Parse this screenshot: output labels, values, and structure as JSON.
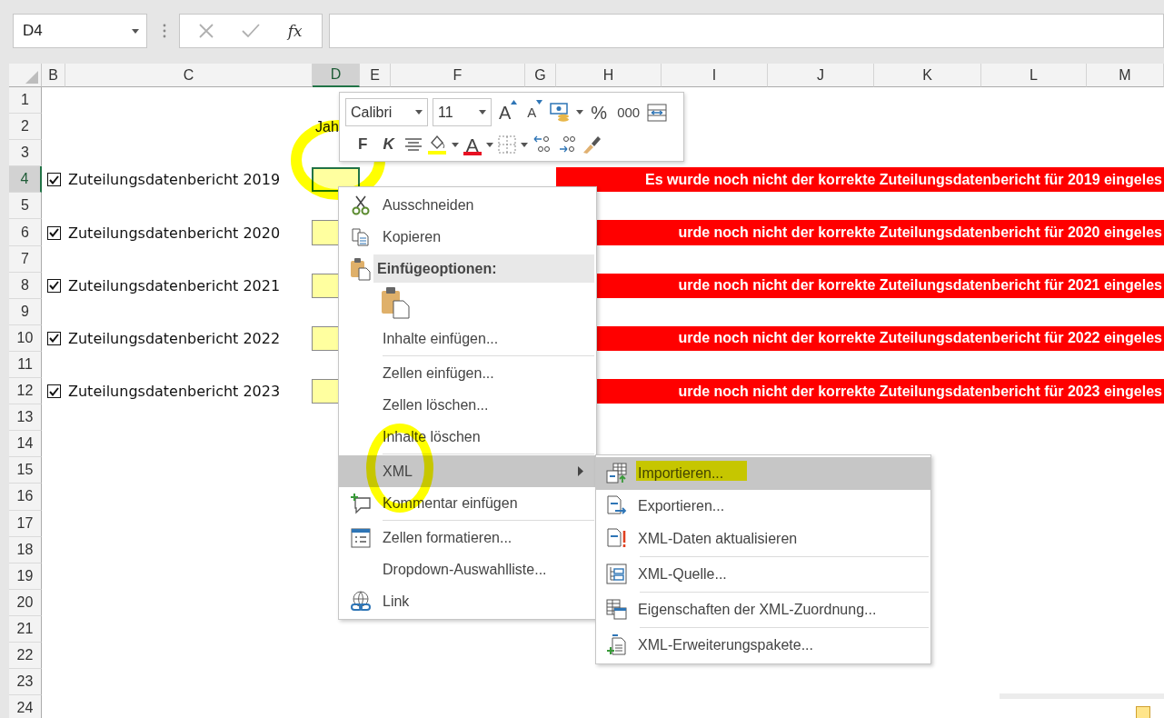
{
  "formula_bar": {
    "name_box": "D4",
    "function_label": "fx"
  },
  "columns": [
    {
      "label": "B",
      "selected": false
    },
    {
      "label": "C",
      "selected": false
    },
    {
      "label": "D",
      "selected": true
    },
    {
      "label": "E",
      "selected": false
    },
    {
      "label": "F",
      "selected": false
    },
    {
      "label": "G",
      "selected": false
    },
    {
      "label": "H",
      "selected": false
    },
    {
      "label": "I",
      "selected": false
    },
    {
      "label": "J",
      "selected": false
    },
    {
      "label": "K",
      "selected": false
    },
    {
      "label": "L",
      "selected": false
    },
    {
      "label": "M",
      "selected": false
    }
  ],
  "rows": [
    {
      "header": "1",
      "selected": false
    },
    {
      "header": "2",
      "selected": false,
      "note": "Jah"
    },
    {
      "header": "3",
      "selected": false
    },
    {
      "header": "4",
      "selected": true,
      "checkbox": {
        "checked": true,
        "label": "Zuteilungsdatenbericht 2019"
      },
      "input_cell": {
        "selected": true
      },
      "warning": "Es wurde noch nicht der korrekte Zuteilungsdatenbericht für 2019 eingeles"
    },
    {
      "header": "5",
      "selected": false
    },
    {
      "header": "6",
      "selected": false,
      "checkbox": {
        "checked": true,
        "label": "Zuteilungsdatenbericht 2020"
      },
      "input_cell": {
        "selected": false
      },
      "warning": "urde noch nicht der korrekte Zuteilungsdatenbericht für 2020 eingeles"
    },
    {
      "header": "7",
      "selected": false
    },
    {
      "header": "8",
      "selected": false,
      "checkbox": {
        "checked": true,
        "label": "Zuteilungsdatenbericht 2021"
      },
      "input_cell": {
        "selected": false
      },
      "warning": "urde noch nicht der korrekte Zuteilungsdatenbericht für 2021 eingeles"
    },
    {
      "header": "9",
      "selected": false
    },
    {
      "header": "10",
      "selected": false,
      "checkbox": {
        "checked": true,
        "label": "Zuteilungsdatenbericht 2022"
      },
      "input_cell": {
        "selected": false
      },
      "warning": "urde noch nicht der korrekte Zuteilungsdatenbericht für 2022 eingeles"
    },
    {
      "header": "11",
      "selected": false
    },
    {
      "header": "12",
      "selected": false,
      "checkbox": {
        "checked": true,
        "label": "Zuteilungsdatenbericht 2023"
      },
      "input_cell": {
        "selected": false
      },
      "warning": "urde noch nicht der korrekte Zuteilungsdatenbericht für 2023 eingeles"
    },
    {
      "header": "13",
      "selected": false
    },
    {
      "header": "14",
      "selected": false
    },
    {
      "header": "15",
      "selected": false
    },
    {
      "header": "16",
      "selected": false
    },
    {
      "header": "17",
      "selected": false
    },
    {
      "header": "18",
      "selected": false
    },
    {
      "header": "19",
      "selected": false
    },
    {
      "header": "20",
      "selected": false
    },
    {
      "header": "21",
      "selected": false
    },
    {
      "header": "22",
      "selected": false
    },
    {
      "header": "23",
      "selected": false
    },
    {
      "header": "24",
      "selected": false
    }
  ],
  "mini_toolbar": {
    "font": "Calibri",
    "size": "11",
    "grow_label": "A",
    "shrink_label": "A",
    "percent_label": "%",
    "thousands_label": "000",
    "bold_label": "F",
    "italic_label": "K",
    "font_color_label": "A"
  },
  "context_menu": [
    {
      "kind": "command",
      "label": "Ausschneiden",
      "selected": false,
      "separator_after": false
    },
    {
      "kind": "command",
      "label": "Kopieren",
      "selected": false,
      "separator_after": false
    },
    {
      "kind": "header",
      "label": "Einfügeoptionen:"
    },
    {
      "kind": "paste-options"
    },
    {
      "kind": "command",
      "label": "Inhalte einfügen...",
      "selected": false,
      "separator_after": true
    },
    {
      "kind": "command",
      "label": "Zellen einfügen...",
      "selected": false,
      "separator_after": false
    },
    {
      "kind": "command",
      "label": "Zellen löschen...",
      "selected": false,
      "separator_after": false
    },
    {
      "kind": "command",
      "label": "Inhalte löschen",
      "selected": false,
      "separator_after": true
    },
    {
      "kind": "submenu",
      "label": "XML",
      "selected": true,
      "separator_after": false
    },
    {
      "kind": "command",
      "label": "Kommentar einfügen",
      "selected": false,
      "separator_after": true
    },
    {
      "kind": "command",
      "label": "Zellen formatieren...",
      "selected": false,
      "separator_after": false
    },
    {
      "kind": "command",
      "label": "Dropdown-Auswahlliste...",
      "selected": false,
      "separator_after": false
    },
    {
      "kind": "command",
      "label": "Link",
      "selected": false,
      "separator_after": false
    }
  ],
  "xml_submenu": [
    {
      "label": "Importieren...",
      "selected": true,
      "separator_after": false
    },
    {
      "label": "Exportieren...",
      "selected": false,
      "separator_after": false
    },
    {
      "label": "XML-Daten aktualisieren",
      "selected": false,
      "separator_after": true
    },
    {
      "label": "XML-Quelle...",
      "selected": false,
      "separator_after": true
    },
    {
      "label": "Eigenschaften der XML-Zuordnung...",
      "selected": false,
      "separator_after": true
    },
    {
      "label": "XML-Erweiterungspakete...",
      "selected": false,
      "separator_after": false
    }
  ]
}
